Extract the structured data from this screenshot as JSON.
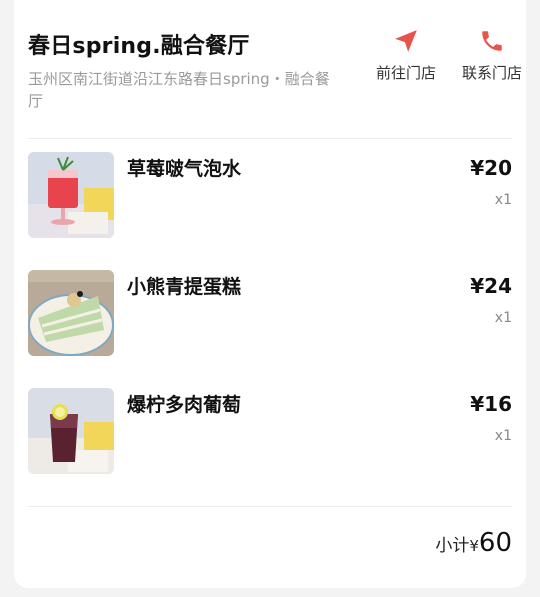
{
  "store": {
    "name": "春日spring.融合餐厅",
    "address": "玉州区南江街道沿江东路春日spring・融合餐厅"
  },
  "actions": {
    "navigate_label": "前往门店",
    "call_label": "联系门店"
  },
  "items": [
    {
      "name": "草莓啵气泡水",
      "price": "¥20",
      "qty": "x1"
    },
    {
      "name": "小熊青提蛋糕",
      "price": "¥24",
      "qty": "x1"
    },
    {
      "name": "爆柠多肉葡萄",
      "price": "¥16",
      "qty": "x1"
    }
  ],
  "subtotal": {
    "label": "小计",
    "currency": "¥",
    "amount": "60"
  },
  "colors": {
    "accent": "#e8544a",
    "muted_text": "#9a9a9a"
  },
  "icons": {
    "navigate": "navigation-arrow-icon",
    "call": "phone-icon"
  }
}
